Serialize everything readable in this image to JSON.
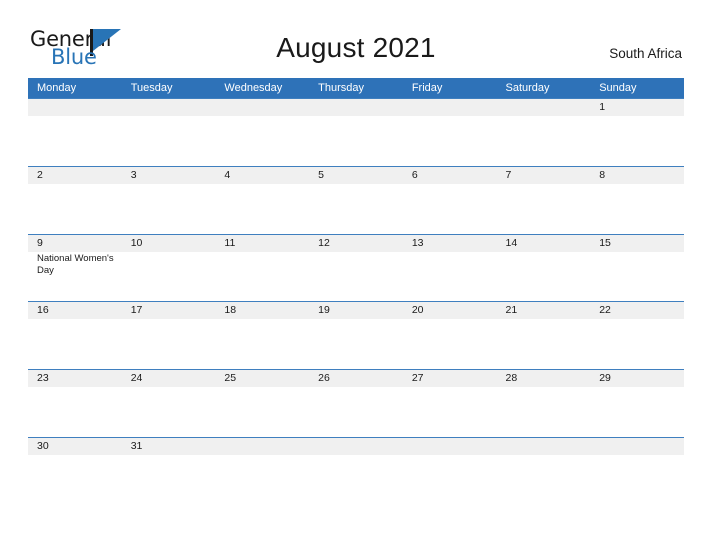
{
  "brand": {
    "word_one": "General",
    "word_two": "Blue",
    "mark": "flag-triangle"
  },
  "header": {
    "title": "August 2021",
    "country": "South Africa"
  },
  "colors": {
    "header_blue": "#2e72b8",
    "row_line_blue": "#3f7fbf",
    "band_gray": "#f0f0f0",
    "brand_blue": "#2874b6",
    "text_dark": "#1a1a1a"
  },
  "calendar": {
    "weekdays": [
      "Monday",
      "Tuesday",
      "Wednesday",
      "Thursday",
      "Friday",
      "Saturday",
      "Sunday"
    ],
    "weeks": [
      [
        {
          "day": "",
          "event": ""
        },
        {
          "day": "",
          "event": ""
        },
        {
          "day": "",
          "event": ""
        },
        {
          "day": "",
          "event": ""
        },
        {
          "day": "",
          "event": ""
        },
        {
          "day": "",
          "event": ""
        },
        {
          "day": "1",
          "event": ""
        }
      ],
      [
        {
          "day": "2",
          "event": ""
        },
        {
          "day": "3",
          "event": ""
        },
        {
          "day": "4",
          "event": ""
        },
        {
          "day": "5",
          "event": ""
        },
        {
          "day": "6",
          "event": ""
        },
        {
          "day": "7",
          "event": ""
        },
        {
          "day": "8",
          "event": ""
        }
      ],
      [
        {
          "day": "9",
          "event": "National Women's Day"
        },
        {
          "day": "10",
          "event": ""
        },
        {
          "day": "11",
          "event": ""
        },
        {
          "day": "12",
          "event": ""
        },
        {
          "day": "13",
          "event": ""
        },
        {
          "day": "14",
          "event": ""
        },
        {
          "day": "15",
          "event": ""
        }
      ],
      [
        {
          "day": "16",
          "event": ""
        },
        {
          "day": "17",
          "event": ""
        },
        {
          "day": "18",
          "event": ""
        },
        {
          "day": "19",
          "event": ""
        },
        {
          "day": "20",
          "event": ""
        },
        {
          "day": "21",
          "event": ""
        },
        {
          "day": "22",
          "event": ""
        }
      ],
      [
        {
          "day": "23",
          "event": ""
        },
        {
          "day": "24",
          "event": ""
        },
        {
          "day": "25",
          "event": ""
        },
        {
          "day": "26",
          "event": ""
        },
        {
          "day": "27",
          "event": ""
        },
        {
          "day": "28",
          "event": ""
        },
        {
          "day": "29",
          "event": ""
        }
      ],
      [
        {
          "day": "30",
          "event": ""
        },
        {
          "day": "31",
          "event": ""
        },
        {
          "day": "",
          "event": ""
        },
        {
          "day": "",
          "event": ""
        },
        {
          "day": "",
          "event": ""
        },
        {
          "day": "",
          "event": ""
        },
        {
          "day": "",
          "event": ""
        }
      ]
    ]
  }
}
